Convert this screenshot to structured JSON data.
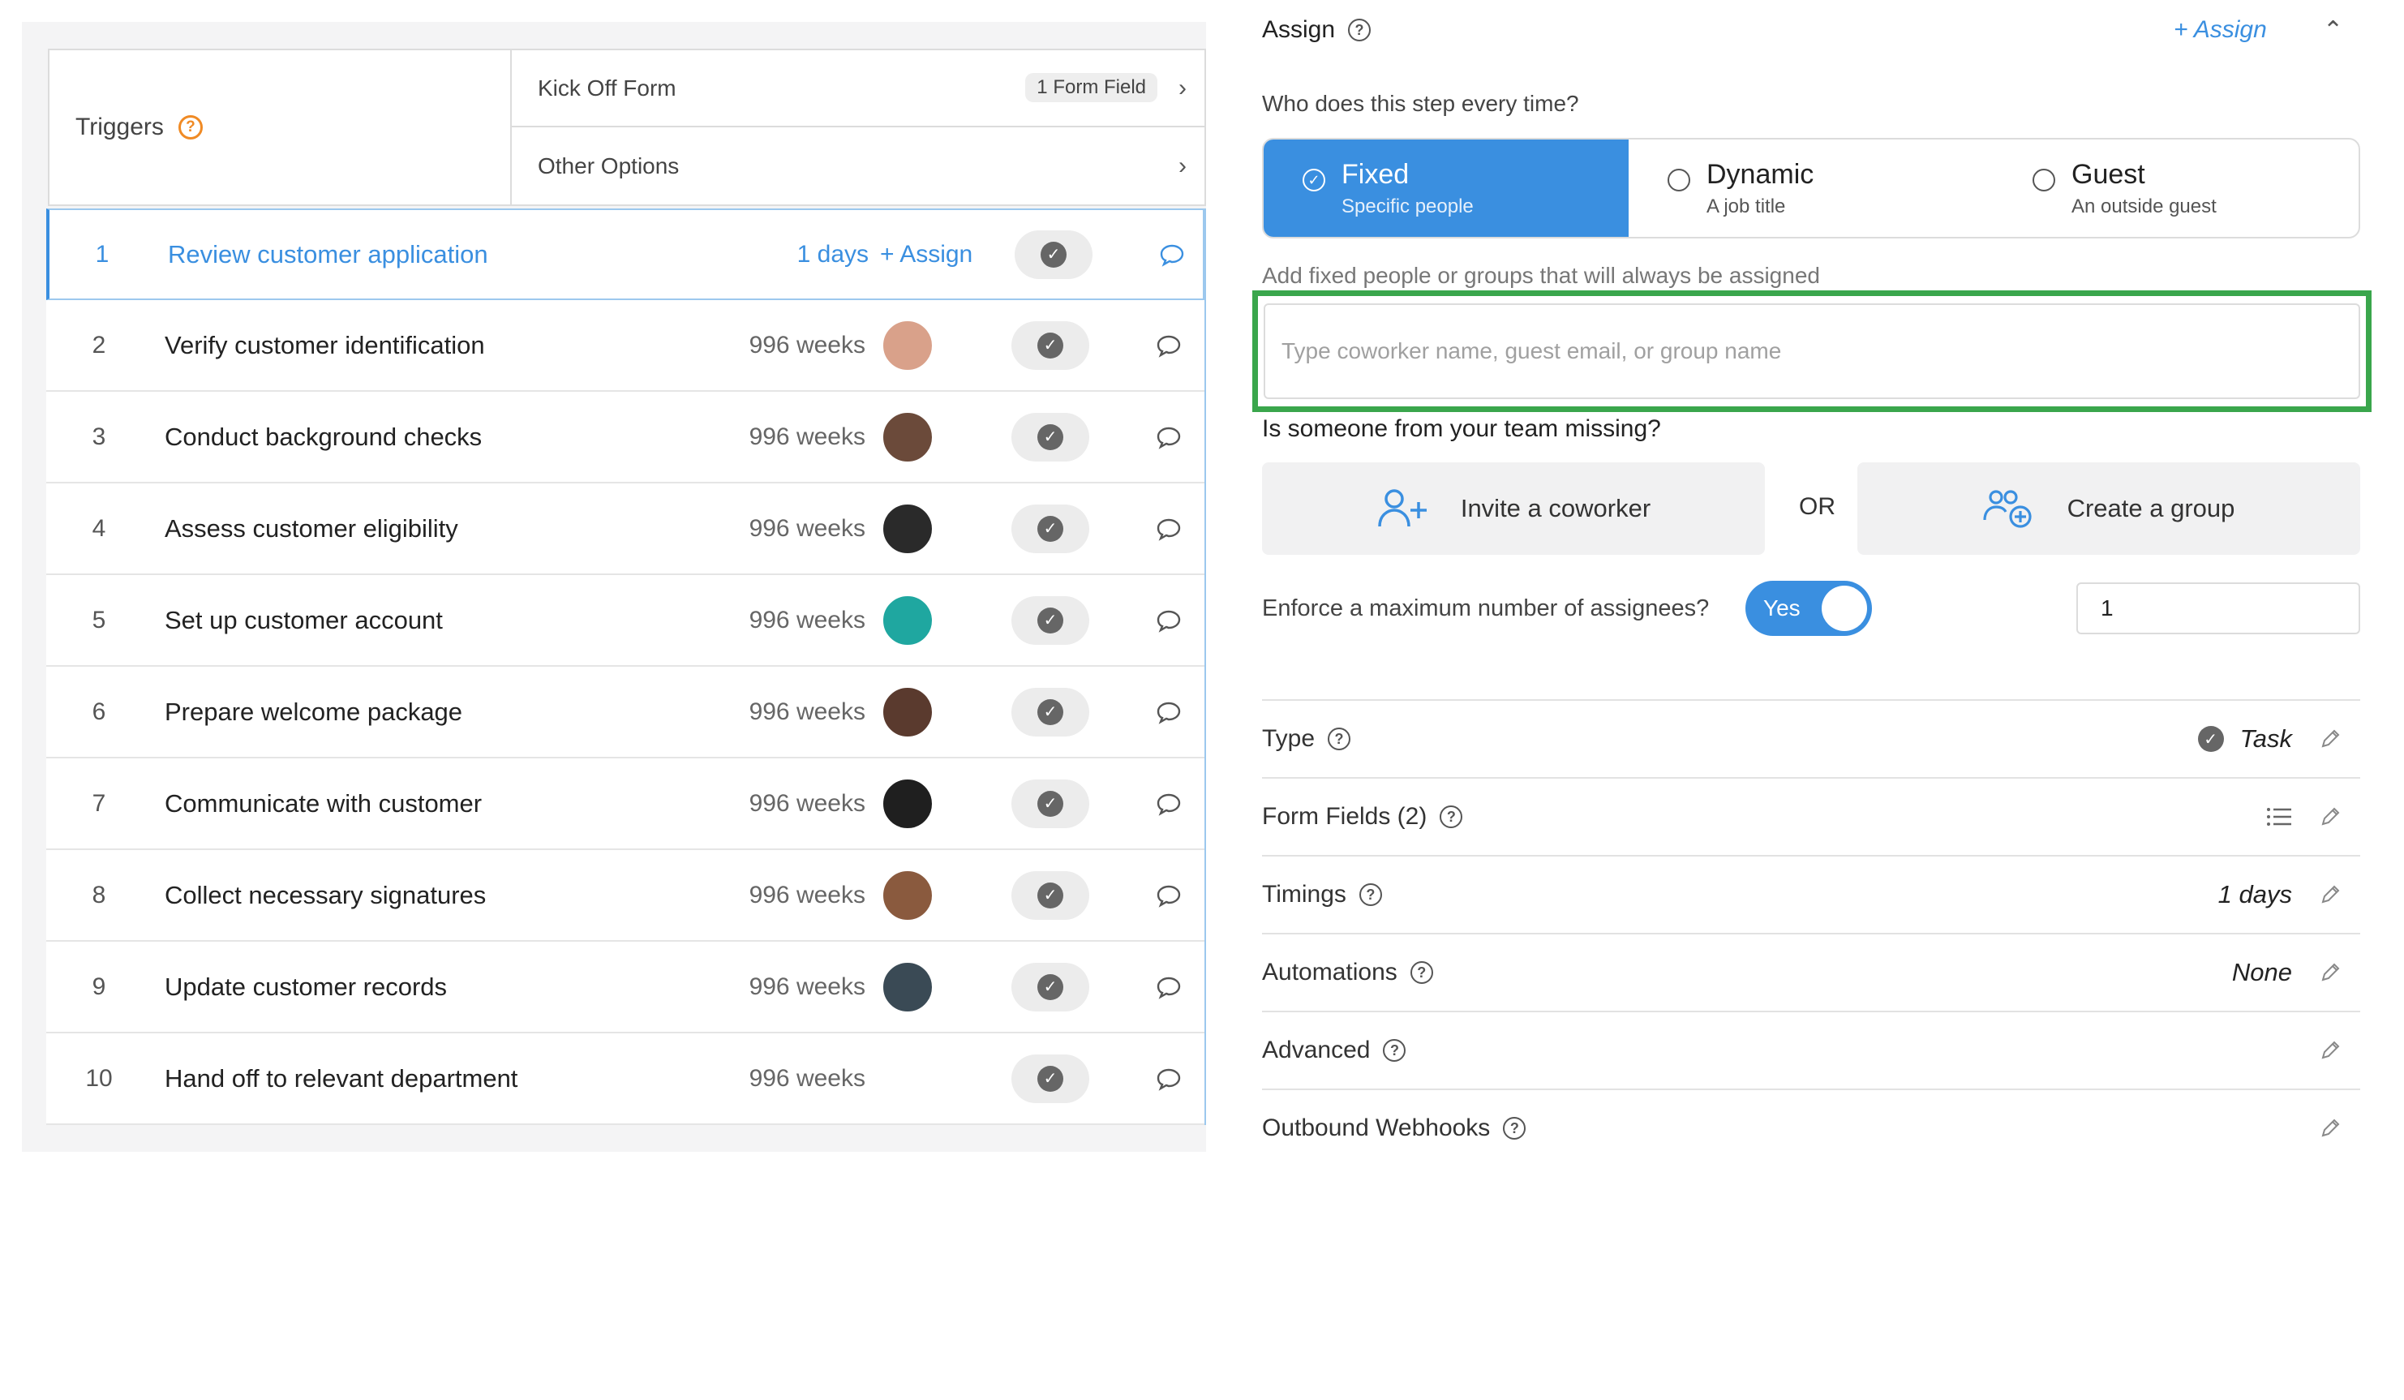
{
  "triggers": {
    "label": "Triggers",
    "kickoff_label": "Kick Off Form",
    "kickoff_tag": "1 Form Field",
    "other_label": "Other Options"
  },
  "steps": [
    {
      "num": "1",
      "title": "Review customer application",
      "duration": "1 days",
      "assign": "+ Assign",
      "avatar": null
    },
    {
      "num": "2",
      "title": "Verify customer identification",
      "duration": "996 weeks",
      "avatar": "#d9a18a"
    },
    {
      "num": "3",
      "title": "Conduct background checks",
      "duration": "996 weeks",
      "avatar": "#6b4a3a"
    },
    {
      "num": "4",
      "title": "Assess customer eligibility",
      "duration": "996 weeks",
      "avatar": "#2a2a2a"
    },
    {
      "num": "5",
      "title": "Set up customer account",
      "duration": "996 weeks",
      "avatar": "#1fa7a0"
    },
    {
      "num": "6",
      "title": "Prepare welcome package",
      "duration": "996 weeks",
      "avatar": "#5a3a2e"
    },
    {
      "num": "7",
      "title": "Communicate with customer",
      "duration": "996 weeks",
      "avatar": "#1f1f1f"
    },
    {
      "num": "8",
      "title": "Collect necessary signatures",
      "duration": "996 weeks",
      "avatar": "#8a5a3e"
    },
    {
      "num": "9",
      "title": "Update customer records",
      "duration": "996 weeks",
      "avatar": "#3a4a55"
    },
    {
      "num": "10",
      "title": "Hand off to relevant department",
      "duration": "996 weeks",
      "avatar": null
    }
  ],
  "assign": {
    "title": "Assign",
    "add_link": "+ Assign",
    "question": "Who does this step every time?",
    "options": [
      {
        "label": "Fixed",
        "sub": "Specific people"
      },
      {
        "label": "Dynamic",
        "sub": "A job title"
      },
      {
        "label": "Guest",
        "sub": "An outside guest"
      }
    ],
    "hint": "Add fixed people or groups that will always be assigned",
    "search_placeholder": "Type coworker name, guest email, or group name",
    "missing": "Is someone from your team missing?",
    "invite_label": "Invite a coworker",
    "or_label": "OR",
    "group_label": "Create a group",
    "enforce_label": "Enforce a maximum number of assignees?",
    "toggle_label": "Yes",
    "max_value": "1"
  },
  "props": {
    "type_label": "Type",
    "type_value": "Task",
    "form_fields_label": "Form Fields (2)",
    "timings_label": "Timings",
    "timings_value": "1 days",
    "automations_label": "Automations",
    "automations_value": "None",
    "advanced_label": "Advanced",
    "webhooks_label": "Outbound Webhooks"
  },
  "colors": {
    "accent": "#3a8fe0",
    "highlight": "#3aa64c",
    "help_orange": "#f08a24"
  }
}
